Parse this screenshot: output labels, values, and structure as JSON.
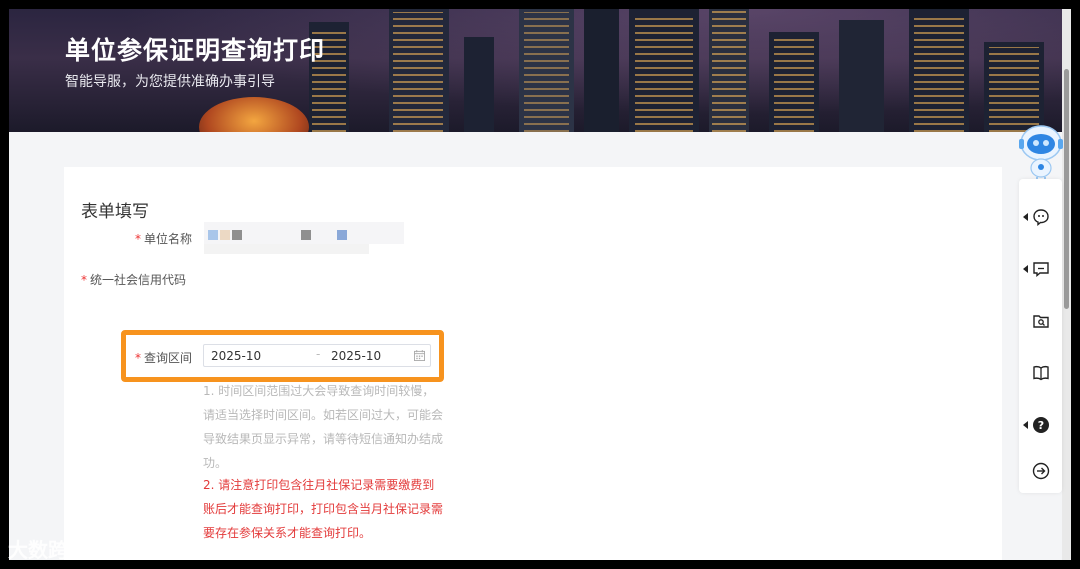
{
  "banner": {
    "title": "单位参保证明查询打印",
    "subtitle": "智能导服，为您提供准确办事引导"
  },
  "form": {
    "section_title": "表单填写",
    "fields": {
      "company_name": {
        "label": "单位名称",
        "required": true
      },
      "credit_code": {
        "label": "统一社会信用代码",
        "required": true
      },
      "query_range": {
        "label": "查询区间",
        "required": true,
        "start": "2025-10",
        "separator": "-",
        "end": "2025-10"
      }
    },
    "notes": {
      "gray": "1. 时间区间范围过大会导致查询时间较慢，请适当选择时间区间。如若区间过大，可能会导致结果页显示异常，请等待短信通知办结成功。",
      "red": "2. 请注意打印包含往月社保记录需要缴费到账后才能查询打印，打印包含当月社保记录需要存在参保关系才能查询打印。"
    }
  },
  "sidebar": {
    "items": [
      {
        "icon": "robot-assistant-icon"
      },
      {
        "icon": "chat-bubble-icon"
      },
      {
        "icon": "message-icon"
      },
      {
        "icon": "folder-search-icon"
      },
      {
        "icon": "book-icon"
      },
      {
        "icon": "help-icon"
      },
      {
        "icon": "arrow-right-circle-icon"
      }
    ]
  },
  "watermark": "大数跨境",
  "colors": {
    "highlight": "#f7931e",
    "required": "#e33a3a",
    "note_gray": "#b8b8b8"
  }
}
